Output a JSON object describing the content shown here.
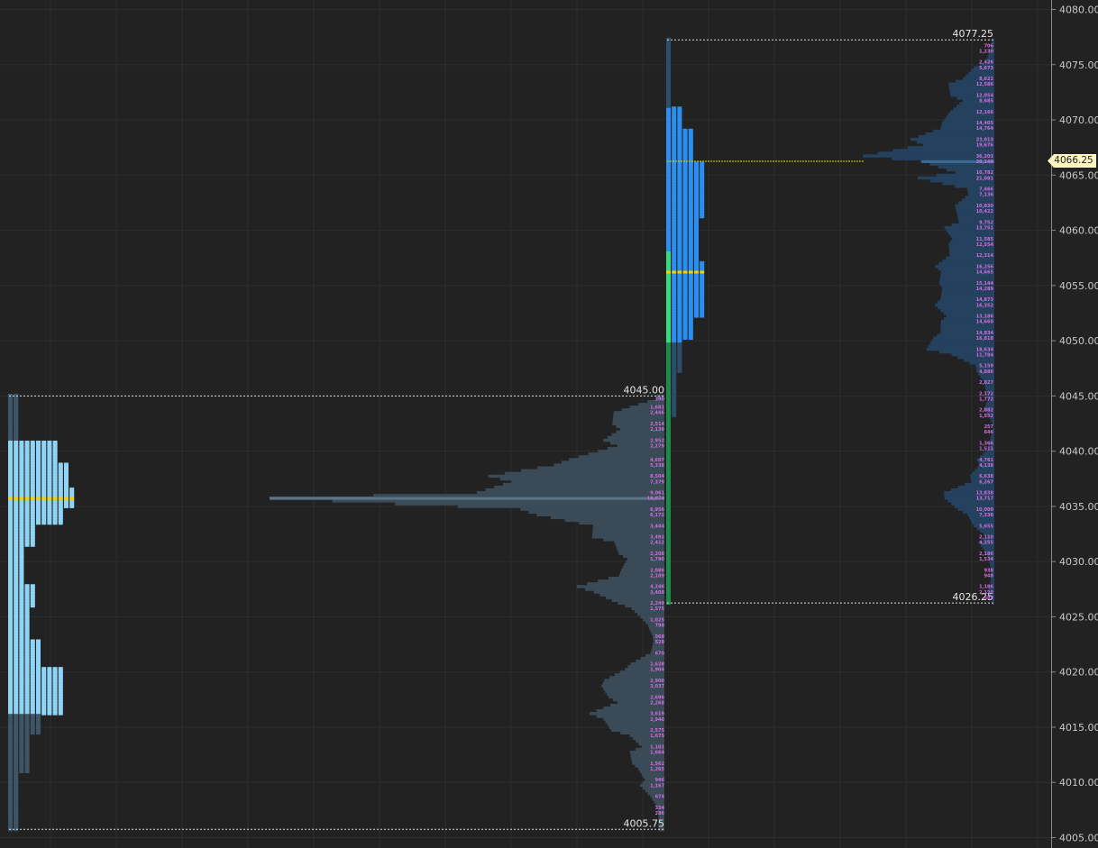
{
  "colors": {
    "background": "#222222",
    "grid": "#2e2e2e",
    "axis_text": "#c8c8c8",
    "tpo_value_area_left": "#8fd3f5",
    "tpo_outside_left": "#3d5566",
    "tpo_value_area_right": "#2a8ff0",
    "tpo_outside_right": "#2c4d6c",
    "tpo_green": "#1d8a4a",
    "tpo_bright_green": "#2fe07a",
    "poc_yellow": "#f5d000",
    "volume_left": "#3a4a57",
    "volume_left_poc": "#5a7485",
    "volume_right": "#24415e",
    "volume_right_poc": "#3a6b94",
    "volume_label": "#d070e0",
    "current_price_tag": "#fff6c0"
  },
  "chart_data": {
    "type": "bar",
    "title": "",
    "ylabel": "",
    "ylim": [
      4005,
      4080
    ],
    "y_ticks": [
      "4005.00",
      "4010.00",
      "4015.00",
      "4020.00",
      "4025.00",
      "4030.00",
      "4035.00",
      "4040.00",
      "4045.00",
      "4050.00",
      "4055.00",
      "4060.00",
      "4065.00",
      "4070.00",
      "4075.00",
      "4080.00"
    ],
    "grid": true,
    "current_price": "4066.25",
    "profiles": [
      {
        "name": "",
        "high_label": "4045.00",
        "low_label": "4005.75",
        "high": 4045.0,
        "low": 4005.75,
        "poc": 4035.75,
        "tpo_counts_by_band": [
          {
            "from": 4045.0,
            "to": 4041.0,
            "count": 2
          },
          {
            "from": 4040.75,
            "to": 4039.0,
            "count": 9
          },
          {
            "from": 4038.75,
            "to": 4036.75,
            "count": 11
          },
          {
            "from": 4036.5,
            "to": 4035.0,
            "count": 12
          },
          {
            "from": 4034.75,
            "to": 4033.5,
            "count": 10
          },
          {
            "from": 4033.25,
            "to": 4031.5,
            "count": 5
          },
          {
            "from": 4031.25,
            "to": 4028.0,
            "count": 3
          },
          {
            "from": 4027.75,
            "to": 4026.0,
            "count": 5
          },
          {
            "from": 4025.75,
            "to": 4023.0,
            "count": 4
          },
          {
            "from": 4022.75,
            "to": 4020.5,
            "count": 6
          },
          {
            "from": 4020.25,
            "to": 4016.25,
            "count": 10
          },
          {
            "from": 4016.0,
            "to": 4014.5,
            "count": 6
          },
          {
            "from": 4014.25,
            "to": 4011.0,
            "count": 4
          },
          {
            "from": 4010.75,
            "to": 4005.75,
            "count": 2
          }
        ],
        "volume_labels": [
          {
            "price": 4044.75,
            "text": "390"
          },
          {
            "price": 4044.0,
            "text": "1,681"
          },
          {
            "price": 4043.5,
            "text": "2,446"
          },
          {
            "price": 4042.5,
            "text": "2,514"
          },
          {
            "price": 4042.0,
            "text": "2,139"
          },
          {
            "price": 4041.0,
            "text": "2,952"
          },
          {
            "price": 4040.5,
            "text": "2,279"
          },
          {
            "price": 4039.25,
            "text": "4,607"
          },
          {
            "price": 4038.75,
            "text": "5,338"
          },
          {
            "price": 4037.75,
            "text": "8,504"
          },
          {
            "price": 4037.25,
            "text": "7,379"
          },
          {
            "price": 4036.25,
            "text": "9,061"
          },
          {
            "price": 4035.75,
            "text": "19,074"
          },
          {
            "price": 4034.75,
            "text": "6,956"
          },
          {
            "price": 4034.25,
            "text": "6,172"
          },
          {
            "price": 4033.25,
            "text": "3,444"
          },
          {
            "price": 4032.25,
            "text": "3,492"
          },
          {
            "price": 4031.75,
            "text": "2,412"
          },
          {
            "price": 4030.75,
            "text": "2,208"
          },
          {
            "price": 4030.25,
            "text": "1,790"
          },
          {
            "price": 4029.25,
            "text": "2,086"
          },
          {
            "price": 4028.75,
            "text": "2,189"
          },
          {
            "price": 4027.75,
            "text": "4,246"
          },
          {
            "price": 4027.25,
            "text": "3,408"
          },
          {
            "price": 4026.25,
            "text": "2,249"
          },
          {
            "price": 4025.75,
            "text": "1,575"
          },
          {
            "price": 4024.75,
            "text": "1,025"
          },
          {
            "price": 4024.25,
            "text": "798"
          },
          {
            "price": 4023.25,
            "text": "568"
          },
          {
            "price": 4022.75,
            "text": "528"
          },
          {
            "price": 4021.75,
            "text": "670"
          },
          {
            "price": 4020.75,
            "text": "1,628"
          },
          {
            "price": 4020.25,
            "text": "1,904"
          },
          {
            "price": 4019.25,
            "text": "2,900"
          },
          {
            "price": 4018.75,
            "text": "3,037"
          },
          {
            "price": 4017.75,
            "text": "2,696"
          },
          {
            "price": 4017.25,
            "text": "2,268"
          },
          {
            "price": 4016.25,
            "text": "3,619"
          },
          {
            "price": 4015.75,
            "text": "2,940"
          },
          {
            "price": 4014.75,
            "text": "2,575"
          },
          {
            "price": 4014.25,
            "text": "1,675"
          },
          {
            "price": 4013.25,
            "text": "1,101"
          },
          {
            "price": 4012.75,
            "text": "1,664"
          },
          {
            "price": 4011.75,
            "text": "1,562"
          },
          {
            "price": 4011.25,
            "text": "1,265"
          },
          {
            "price": 4010.25,
            "text": "946"
          },
          {
            "price": 4009.75,
            "text": "1,167"
          },
          {
            "price": 4008.75,
            "text": "674"
          },
          {
            "price": 4007.75,
            "text": "334"
          },
          {
            "price": 4007.25,
            "text": "286"
          }
        ]
      },
      {
        "name": "",
        "high_label": "4077.25",
        "low_label": "4026.25",
        "high": 4077.25,
        "low": 4026.25,
        "poc": 4066.25,
        "value_area": [
          4050.0,
          4071.0
        ],
        "poc_tpo": 4056.25,
        "volume_labels": [
          {
            "price": 4076.75,
            "text": "706"
          },
          {
            "price": 4076.25,
            "text": "1,230"
          },
          {
            "price": 4075.25,
            "text": "2,426"
          },
          {
            "price": 4074.75,
            "text": "5,673"
          },
          {
            "price": 4073.75,
            "text": "8,622"
          },
          {
            "price": 4073.25,
            "text": "12,586"
          },
          {
            "price": 4072.25,
            "text": "12,054"
          },
          {
            "price": 4071.75,
            "text": "8,685"
          },
          {
            "price": 4070.75,
            "text": "12,166"
          },
          {
            "price": 4069.75,
            "text": "14,405"
          },
          {
            "price": 4069.25,
            "text": "14,764"
          },
          {
            "price": 4068.25,
            "text": "23,013"
          },
          {
            "price": 4067.75,
            "text": "19,676"
          },
          {
            "price": 4066.75,
            "text": "36,203"
          },
          {
            "price": 4066.25,
            "text": "20,148"
          },
          {
            "price": 4065.25,
            "text": "10,782"
          },
          {
            "price": 4064.75,
            "text": "21,081"
          },
          {
            "price": 4063.75,
            "text": "7,466"
          },
          {
            "price": 4063.25,
            "text": "7,136"
          },
          {
            "price": 4062.25,
            "text": "10,830"
          },
          {
            "price": 4061.75,
            "text": "10,422"
          },
          {
            "price": 4060.75,
            "text": "9,752"
          },
          {
            "price": 4060.25,
            "text": "13,751"
          },
          {
            "price": 4059.25,
            "text": "11,585"
          },
          {
            "price": 4058.75,
            "text": "12,554"
          },
          {
            "price": 4057.75,
            "text": "12,314"
          },
          {
            "price": 4056.75,
            "text": "16,256"
          },
          {
            "price": 4056.25,
            "text": "14,665"
          },
          {
            "price": 4055.25,
            "text": "15,144"
          },
          {
            "price": 4054.75,
            "text": "14,289"
          },
          {
            "price": 4053.75,
            "text": "14,873"
          },
          {
            "price": 4053.25,
            "text": "16,352"
          },
          {
            "price": 4052.25,
            "text": "13,186"
          },
          {
            "price": 4051.75,
            "text": "14,660"
          },
          {
            "price": 4050.75,
            "text": "14,834"
          },
          {
            "price": 4050.25,
            "text": "16,818"
          },
          {
            "price": 4049.25,
            "text": "18,634"
          },
          {
            "price": 4048.75,
            "text": "11,784"
          },
          {
            "price": 4047.75,
            "text": "5,159"
          },
          {
            "price": 4047.25,
            "text": "4,886"
          },
          {
            "price": 4046.25,
            "text": "2,827"
          },
          {
            "price": 4045.25,
            "text": "2,172"
          },
          {
            "price": 4044.75,
            "text": "1,772"
          },
          {
            "price": 4043.75,
            "text": "2,882"
          },
          {
            "price": 4043.25,
            "text": "1,552"
          },
          {
            "price": 4042.25,
            "text": "257"
          },
          {
            "price": 4041.75,
            "text": "646"
          },
          {
            "price": 4040.75,
            "text": "1,366"
          },
          {
            "price": 4040.25,
            "text": "1,511"
          },
          {
            "price": 4039.25,
            "text": "4,761"
          },
          {
            "price": 4038.75,
            "text": "4,138"
          },
          {
            "price": 4037.75,
            "text": "6,638"
          },
          {
            "price": 4037.25,
            "text": "6,267"
          },
          {
            "price": 4036.25,
            "text": "13,838"
          },
          {
            "price": 4035.75,
            "text": "13,717"
          },
          {
            "price": 4034.75,
            "text": "10,000"
          },
          {
            "price": 4034.25,
            "text": "7,338"
          },
          {
            "price": 4033.25,
            "text": "5,655"
          },
          {
            "price": 4032.25,
            "text": "2,110"
          },
          {
            "price": 4031.75,
            "text": "4,255"
          },
          {
            "price": 4030.75,
            "text": "2,186"
          },
          {
            "price": 4030.25,
            "text": "1,534"
          },
          {
            "price": 4029.25,
            "text": "938"
          },
          {
            "price": 4028.75,
            "text": "948"
          },
          {
            "price": 4027.75,
            "text": "1,186"
          },
          {
            "price": 4027.25,
            "text": "2,120"
          },
          {
            "price": 4026.75,
            "text": "582"
          }
        ]
      }
    ]
  }
}
